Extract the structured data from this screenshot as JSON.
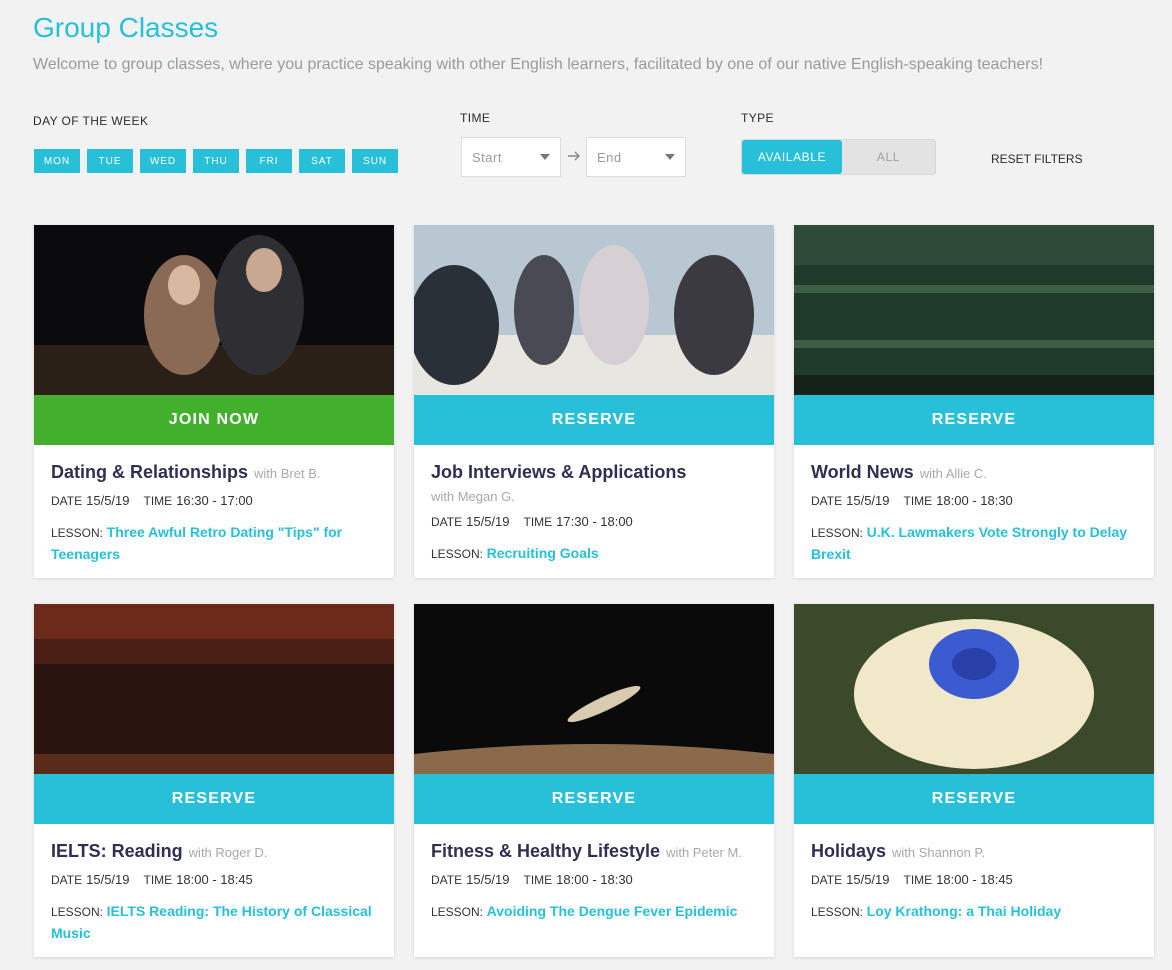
{
  "header": {
    "title": "Group Classes",
    "subtitle": "Welcome to group classes, where you practice speaking with other English learners, facilitated by one of our native English-speaking teachers!"
  },
  "filters": {
    "day_label": "DAY OF THE WEEK",
    "days": [
      "MON",
      "TUE",
      "WED",
      "THU",
      "FRI",
      "SAT",
      "SUN"
    ],
    "time_label": "TIME",
    "time_start_placeholder": "Start",
    "time_end_placeholder": "End",
    "type_label": "TYPE",
    "type_available": "AVAILABLE",
    "type_all": "ALL",
    "type_selected": "AVAILABLE",
    "reset": "RESET FILTERS"
  },
  "labels": {
    "date": "DATE",
    "time": "TIME",
    "lesson": "LESSON:"
  },
  "colors": {
    "accent": "#27c0d8",
    "join": "#42b02c",
    "title": "#2f2f54"
  },
  "cards": [
    {
      "action": "JOIN NOW",
      "title": "Dating & Relationships",
      "teacher": "with Bret B.",
      "date": "15/5/19",
      "time": "16:30 - 17:00",
      "lesson": "Three Awful Retro Dating \"Tips\" for Teenagers"
    },
    {
      "action": "RESERVE",
      "title": "Job Interviews & Applications",
      "teacher": "with Megan G.",
      "date": "15/5/19",
      "time": "17:30 - 18:00",
      "lesson": "Recruiting Goals"
    },
    {
      "action": "RESERVE",
      "title": "World News",
      "teacher": "with Allie C.",
      "date": "15/5/19",
      "time": "18:00 - 18:30",
      "lesson": "U.K. Lawmakers Vote Strongly to Delay Brexit"
    },
    {
      "action": "RESERVE",
      "title": "IELTS: Reading",
      "teacher": "with Roger D.",
      "date": "15/5/19",
      "time": "18:00 - 18:45",
      "lesson": "IELTS Reading: The History of Classical Music"
    },
    {
      "action": "RESERVE",
      "title": "Fitness & Healthy Lifestyle",
      "teacher": "with Peter M.",
      "date": "15/5/19",
      "time": "18:00 - 18:30",
      "lesson": "Avoiding The Dengue Fever Epidemic"
    },
    {
      "action": "RESERVE",
      "title": "Holidays",
      "teacher": "with Shannon P.",
      "date": "15/5/19",
      "time": "18:00 - 18:45",
      "lesson": "Loy Krathong: a Thai Holiday"
    }
  ]
}
